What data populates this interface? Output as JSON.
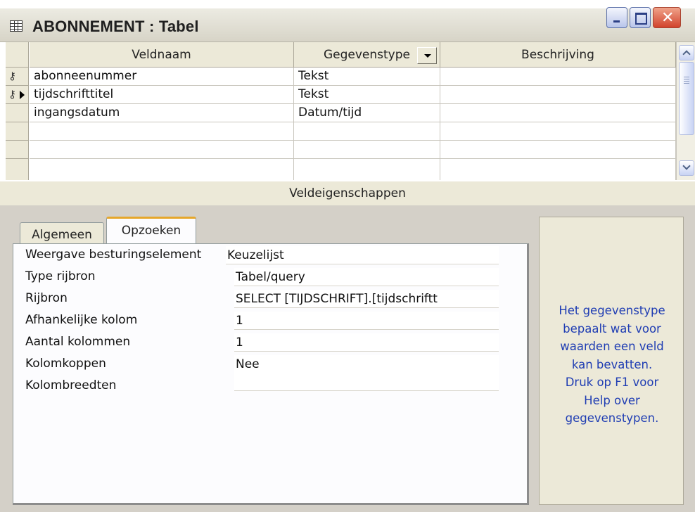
{
  "window": {
    "title": "ABONNEMENT : Tabel"
  },
  "grid": {
    "columns": [
      "Veldnaam",
      "Gegevenstype",
      "Beschrijving"
    ],
    "rows": [
      {
        "name": "abonneenummer",
        "type": "Tekst",
        "description": "",
        "primary_key": true,
        "current": false
      },
      {
        "name": "tijdschrifttitel",
        "type": "Tekst",
        "description": "",
        "primary_key": true,
        "current": true
      },
      {
        "name": "ingangsdatum",
        "type": "Datum/tijd",
        "description": "",
        "primary_key": false,
        "current": false
      },
      {
        "name": "",
        "type": "",
        "description": ""
      },
      {
        "name": "",
        "type": "",
        "description": ""
      },
      {
        "name": "",
        "type": "",
        "description": ""
      }
    ]
  },
  "properties": {
    "header": "Veldeigenschappen",
    "tabs": [
      "Algemeen",
      "Opzoeken"
    ],
    "active_tab": "Opzoeken",
    "items": [
      {
        "label": "Weergave besturingselement",
        "value": "Keuzelijst"
      },
      {
        "label": "Type rijbron",
        "value": "Tabel/query"
      },
      {
        "label": "Rijbron",
        "value": "SELECT [TIJDSCHRIFT].[tijdschriftt"
      },
      {
        "label": "Afhankelijke kolom",
        "value": "1"
      },
      {
        "label": "Aantal kolommen",
        "value": "1"
      },
      {
        "label": "Kolomkoppen",
        "value": "Nee"
      },
      {
        "label": "Kolombreedten",
        "value": ""
      }
    ]
  },
  "help": {
    "lines": [
      "Het gegevenstype",
      "bepaalt wat voor",
      "waarden een veld",
      "kan bevatten.",
      "Druk op F1 voor",
      "Help over",
      "gegevenstypen."
    ]
  },
  "icons": {
    "table": "table-icon",
    "key": "primary-key-icon",
    "row_pointer": "current-row-arrow-icon"
  }
}
